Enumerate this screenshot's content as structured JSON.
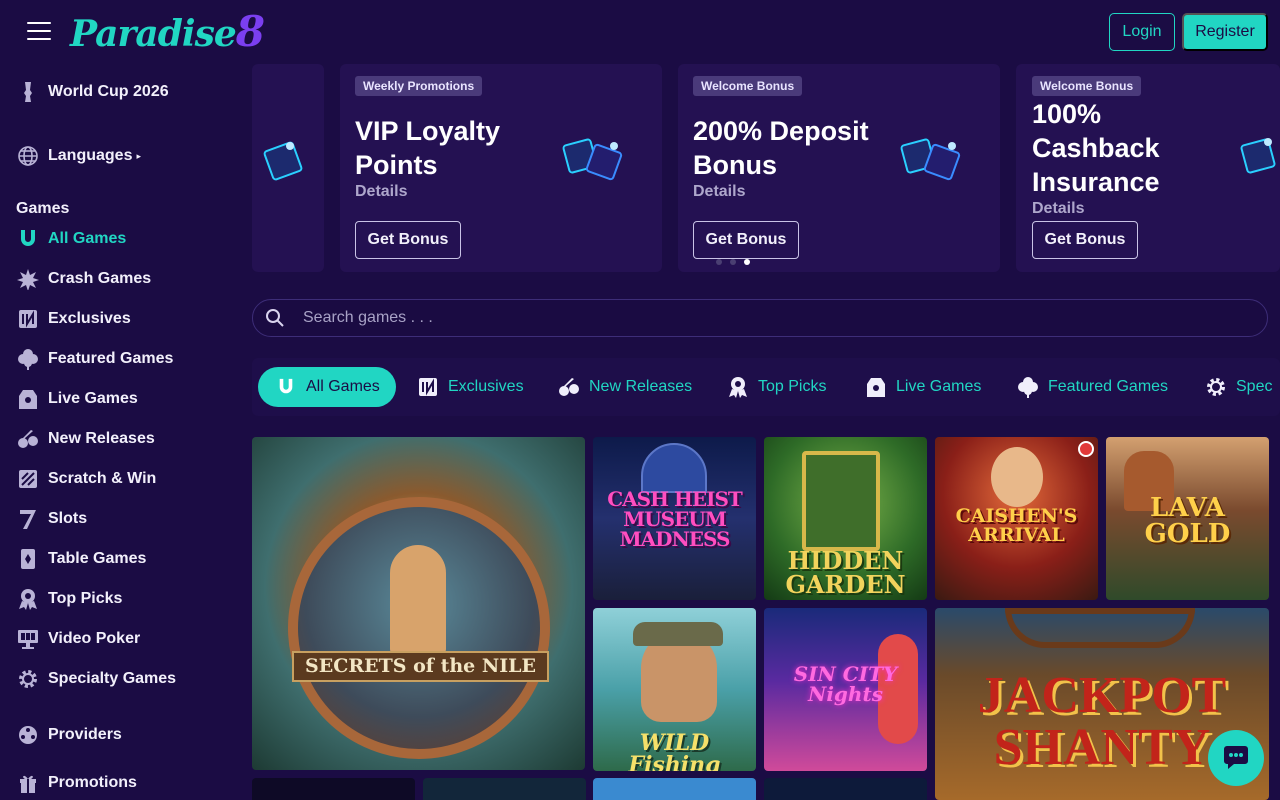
{
  "header": {
    "logo_text": "Paradise",
    "logo_digit": "8",
    "login_label": "Login",
    "register_label": "Register"
  },
  "sidebar": {
    "world_cup": "World Cup 2026",
    "languages": "Languages",
    "games_heading": "Games",
    "items": [
      {
        "label": "All Games",
        "icon": "horseshoe-icon",
        "active": true
      },
      {
        "label": "Crash Games",
        "icon": "explosion-icon"
      },
      {
        "label": "Exclusives",
        "icon": "exclusive-icon"
      },
      {
        "label": "Featured Games",
        "icon": "clover-icon"
      },
      {
        "label": "Live Games",
        "icon": "live-dealer-icon"
      },
      {
        "label": "New Releases",
        "icon": "cherries-icon"
      },
      {
        "label": "Scratch & Win",
        "icon": "scratch-card-icon"
      },
      {
        "label": "Slots",
        "icon": "seven-icon"
      },
      {
        "label": "Table Games",
        "icon": "card-icon"
      },
      {
        "label": "Top Picks",
        "icon": "medal-icon"
      },
      {
        "label": "Video Poker",
        "icon": "video-poker-icon"
      },
      {
        "label": "Specialty Games",
        "icon": "gear-icon"
      }
    ],
    "providers": "Providers",
    "promotions": "Promotions"
  },
  "promos": [
    {
      "tag": "Weekly Promotions",
      "title": "VIP Loyalty Points",
      "details": "Details",
      "button": "Get Bonus"
    },
    {
      "tag": "Welcome Bonus",
      "title": "200% Deposit Bonus",
      "details": "Details",
      "button": "Get Bonus"
    },
    {
      "tag": "Welcome Bonus",
      "title": "100% Cashback Insurance",
      "details": "Details",
      "button": "Get Bonus"
    }
  ],
  "search": {
    "placeholder": "Search games . . ."
  },
  "categories": [
    {
      "label": "All Games",
      "icon": "horseshoe-icon",
      "active": true
    },
    {
      "label": "Exclusives",
      "icon": "exclusive-icon"
    },
    {
      "label": "New Releases",
      "icon": "cherries-icon"
    },
    {
      "label": "Top Picks",
      "icon": "medal-icon"
    },
    {
      "label": "Live Games",
      "icon": "live-dealer-icon"
    },
    {
      "label": "Featured Games",
      "icon": "clover-icon"
    },
    {
      "label": "Spec",
      "icon": "gear-icon"
    }
  ],
  "games": [
    {
      "title": "SECRETS of the NILE"
    },
    {
      "title": "CASH HEIST MUSEUM MADNESS"
    },
    {
      "title": "HIDDEN GARDEN"
    },
    {
      "title": "CAISHEN'S ARRIVAL"
    },
    {
      "title": "LAVA GOLD"
    },
    {
      "title": "WILD Fishing"
    },
    {
      "title": "SIN CITY Nights"
    },
    {
      "title": "JACKPOT SHANTY"
    }
  ],
  "colors": {
    "accent": "#21d6c3",
    "background": "#1b0c44",
    "card": "#241152"
  }
}
